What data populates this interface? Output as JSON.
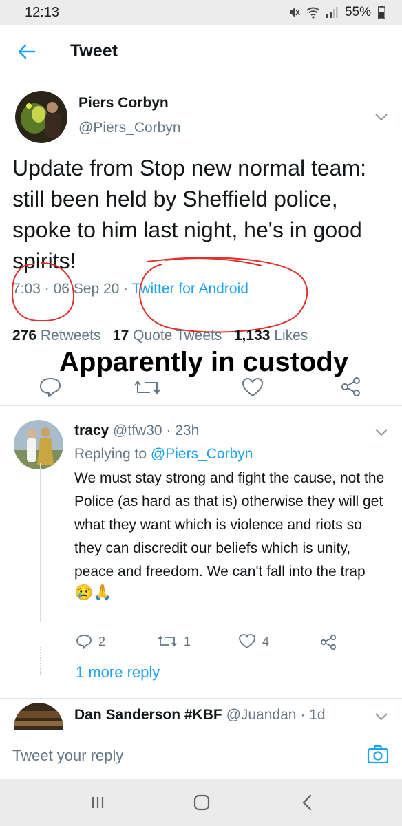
{
  "status_bar": {
    "time": "12:13",
    "battery": "55%"
  },
  "header": {
    "title": "Tweet",
    "back_icon": "arrow-left-icon",
    "accent": "#1da1f2"
  },
  "tweet": {
    "author_name": "Piers Corbyn",
    "author_handle": "@Piers_Corbyn",
    "text": "Update from Stop new normal team: still been held by Sheffield police, spoke to him last night, he's in good spirits!",
    "time": "7:03",
    "date": "06 Sep 20",
    "separator": "·",
    "source": "Twitter for Android",
    "retweets_count": "276",
    "retweets_label": "Retweets",
    "quote_count": "17",
    "quote_label": "Quote Tweets",
    "likes_count": "1,133",
    "likes_label": "Likes",
    "overlay_text": "Apparently in custody",
    "annotation_color": "#e0302a"
  },
  "reply": {
    "name": "tracy",
    "handle": "@tfw30",
    "age": "· 23h",
    "replying_prefix": "Replying to",
    "replying_to": "@Piers_Corbyn",
    "text": "We must stay strong and fight the cause, not the Police (as hard as that is) otherwise they will get what they want which is violence and riots so they can discredit our beliefs which is unity, peace and freedom.  We can't fall into the trap",
    "emoji": "😢🙏",
    "reply_count": "2",
    "retweet_count": "1",
    "like_count": "4",
    "more_replies": "1 more reply"
  },
  "next_reply": {
    "name": "Dan Sanderson #KBF",
    "handle": "@Juandan",
    "age": "· 1d"
  },
  "composer": {
    "placeholder": "Tweet your reply",
    "camera_icon": "camera-icon"
  },
  "nav_bar": {
    "icons": [
      "recent-apps-icon",
      "home-icon",
      "back-icon"
    ]
  }
}
